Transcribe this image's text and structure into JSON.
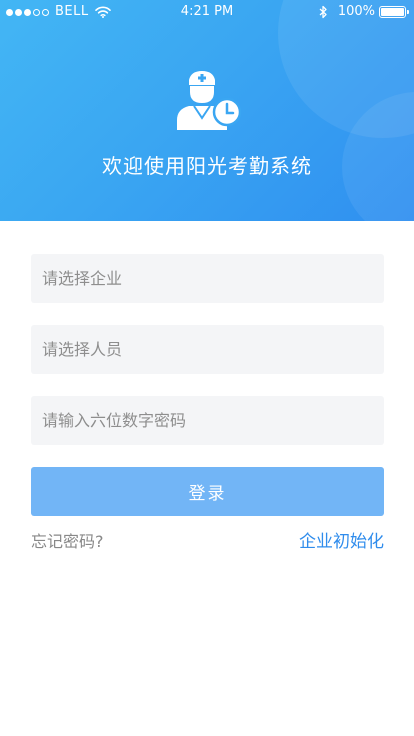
{
  "status_bar": {
    "carrier": "BELL",
    "time": "4:21 PM",
    "battery": "100%",
    "signal_bars_filled": 3,
    "signal_bars_total": 5
  },
  "header": {
    "title": "欢迎使用阳光考勤系统",
    "logo_icon": "doctor-clock-icon"
  },
  "form": {
    "company_placeholder": "请选择企业",
    "person_placeholder": "请选择人员",
    "password_placeholder": "请输入六位数字密码",
    "login_label": "登录"
  },
  "links": {
    "forgot_password": "忘记密码?",
    "company_init": "企业初始化"
  },
  "colors": {
    "header_start": "#43b6f4",
    "header_end": "#2f8ff0",
    "button": "#72b5f6",
    "link": "#2f8cec",
    "field_bg": "#f4f5f7"
  }
}
